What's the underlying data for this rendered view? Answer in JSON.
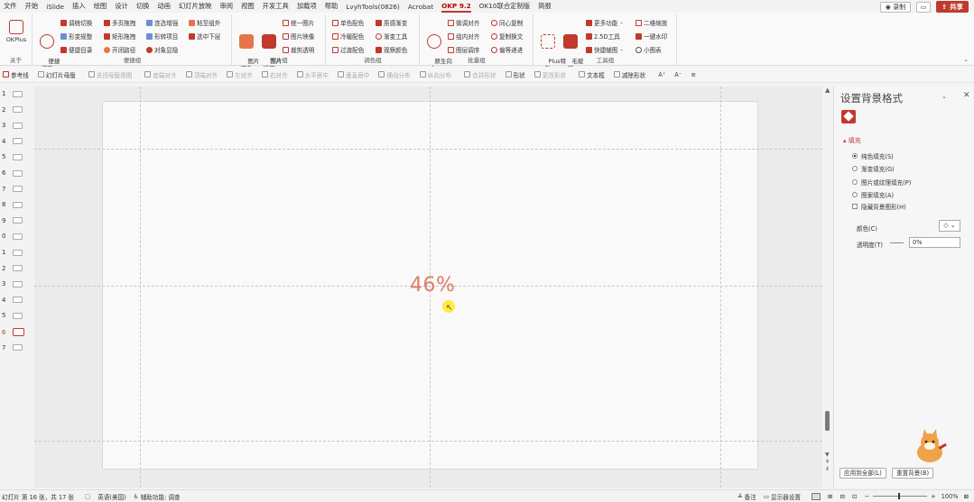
{
  "menu": {
    "tabs": [
      "文件",
      "开始",
      "iSlide",
      "插入",
      "绘图",
      "设计",
      "切换",
      "动画",
      "幻灯片放映",
      "审阅",
      "视图",
      "开发工具",
      "加载项",
      "帮助",
      "LvyhTools(0826)",
      "Acrobat",
      "OKP 9.2",
      "OK10联合定制版",
      "简报"
    ],
    "active_tab": "OKP 9.2",
    "record_label": "◉ 录制",
    "share_label": "共享"
  },
  "ribbon": {
    "groups": {
      "about": {
        "label": "关于",
        "okplus": "OKPlus"
      },
      "quick": {
        "label": "便捷组",
        "big": "便捷\n增强",
        "items": [
          "调统切换",
          "形变规整",
          "便捷目录",
          "多页拖拽",
          "矩形拖拽",
          "开闭路径",
          "连选增强",
          "形转项目",
          "对象显隐",
          "粘至组外",
          "选中下层"
        ]
      },
      "image": {
        "label": "图片组",
        "big1": "图片\n调色",
        "big2": "图片\n透明",
        "items": [
          "统一图片",
          "图片映像",
          "裁剪透明"
        ]
      },
      "color": {
        "label": "调色组",
        "items": [
          "单色配色",
          "冷暖配色",
          "过渡配色",
          "质感渐变",
          "渐变工具",
          "观察颜色"
        ]
      },
      "batch": {
        "label": "批量组",
        "big": "原生向\n尔",
        "items": [
          "微调对齐",
          "组内对齐",
          "图层调序",
          "同心复制",
          "复制换文",
          "偏等递进"
        ]
      },
      "tools": {
        "label": "工具组",
        "big1": "Plus特\n效",
        "big2": "毛玻\n璃",
        "items": [
          "更多功能",
          "2.5D工具",
          "快捷辅图",
          "二维缩放",
          "一键水印",
          "小图表"
        ]
      }
    }
  },
  "toolbar": {
    "items": [
      {
        "label": "参考线",
        "enabled": true
      },
      {
        "label": "幻灯片母版",
        "enabled": true
      },
      {
        "label": "关闭母版视图",
        "enabled": false
      },
      {
        "label": "底端对齐",
        "enabled": false
      },
      {
        "label": "顶端对齐",
        "enabled": false
      },
      {
        "label": "左对齐",
        "enabled": false
      },
      {
        "label": "右对齐",
        "enabled": false
      },
      {
        "label": "水平居中",
        "enabled": false
      },
      {
        "label": "垂直居中",
        "enabled": false
      },
      {
        "label": "横向分布",
        "enabled": false
      },
      {
        "label": "纵向分布",
        "enabled": false
      },
      {
        "label": "合并形状",
        "enabled": false
      },
      {
        "label": "形状",
        "enabled": true
      },
      {
        "label": "更改形状",
        "enabled": false
      },
      {
        "label": "文本框",
        "enabled": true
      },
      {
        "label": "减除形状",
        "enabled": true
      },
      {
        "label": "A⁺",
        "enabled": true
      },
      {
        "label": "A⁻",
        "enabled": true
      },
      {
        "label": "≡",
        "enabled": true
      }
    ]
  },
  "thumbnails": {
    "numbers": [
      "1",
      "2",
      "3",
      "4",
      "5",
      "6",
      "7",
      "8",
      "9",
      "0",
      "1",
      "2",
      "3",
      "4",
      "5",
      "6",
      "7"
    ],
    "selected_index": 15
  },
  "slide": {
    "content": "46%",
    "content_color": "#e07a6a"
  },
  "format_pane": {
    "title": "设置背景格式",
    "section": "填充",
    "options": [
      {
        "label": "纯色填充(S)",
        "checked": true
      },
      {
        "label": "渐变填充(G)",
        "checked": false
      },
      {
        "label": "图片或纹理填充(P)",
        "checked": false
      },
      {
        "label": "图案填充(A)",
        "checked": false
      }
    ],
    "hide_bg_label": "隐藏背景图形(H)",
    "color_label": "颜色(C)",
    "transparency_label": "透明度(T)",
    "transparency_value": "0%",
    "apply_all_label": "应用到全部(L)",
    "reset_label": "重置背景(B)"
  },
  "status": {
    "slide_info": "幻灯片 第 16 张，共 17 张",
    "language": "英语(美国)",
    "accessibility": "辅助功能: 调查",
    "notes": "备注",
    "display": "显示器设置",
    "zoom": "100%"
  },
  "colors": {
    "accent": "#c0392b",
    "bg": "#f3f3f3"
  }
}
